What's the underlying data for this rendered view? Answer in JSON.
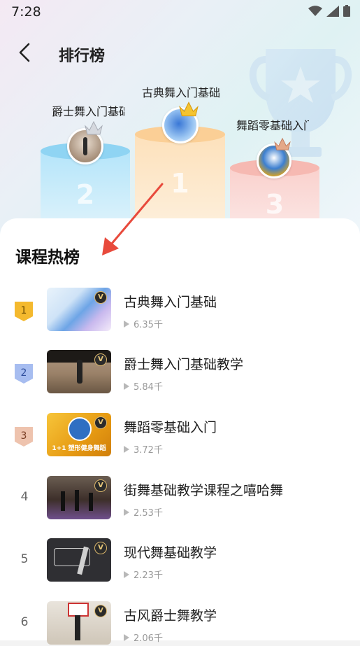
{
  "status": {
    "time": "7:28"
  },
  "header": {
    "title": "排行榜"
  },
  "podium": {
    "first": {
      "name": "古典舞入门基础",
      "rank": "1"
    },
    "second": {
      "name": "爵士舞入门基础教学",
      "rank": "2"
    },
    "third": {
      "name": "舞蹈零基础入门",
      "rank": "3"
    }
  },
  "section": {
    "title": "课程热榜"
  },
  "courses": [
    {
      "rank": "1",
      "title": "古典舞入门基础",
      "plays": "6.35千",
      "badge": "gold"
    },
    {
      "rank": "2",
      "title": "爵士舞入门基础教学",
      "plays": "5.84千",
      "badge": "silver"
    },
    {
      "rank": "3",
      "title": "舞蹈零基础入门",
      "plays": "3.72千",
      "badge": "bronze"
    },
    {
      "rank": "4",
      "title": "街舞基础教学课程之嘻哈舞",
      "plays": "2.53千"
    },
    {
      "rank": "5",
      "title": "现代舞基础教学",
      "plays": "2.23千"
    },
    {
      "rank": "6",
      "title": "古风爵士舞教学",
      "plays": "2.06千"
    }
  ],
  "thumb_text": {
    "vip": "V",
    "course3_banner": "1+1 塑形健身舞蹈"
  },
  "colors": {
    "gold": "#f1b82d",
    "silver": "#7d9be0",
    "bronze": "#e4b8a3",
    "podium_blue": "#aee1f7",
    "podium_orange": "#fde0b8",
    "podium_pink": "#f9d0cc"
  }
}
